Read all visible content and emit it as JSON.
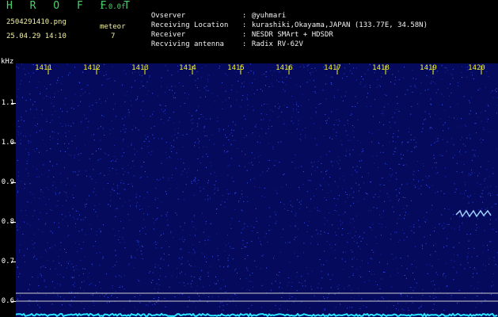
{
  "header": {
    "app_title": "H R O F F T",
    "version": "1.0.0f",
    "filename": "2504291410.png",
    "datetime": "25.04.29 14:10",
    "meteor_label": "meteor",
    "meteor_count": "7"
  },
  "info": [
    {
      "key": "Ovserver",
      "value": "@yuhmari"
    },
    {
      "key": "Receiving Location",
      "value": "kurashiki,Okayama,JAPAN (133.77E, 34.58N)"
    },
    {
      "key": "Receiver",
      "value": "NESDR SMArt + HDSDR"
    },
    {
      "key": "Recviving antenna",
      "value": "Radix RV-62V"
    }
  ],
  "axis": {
    "unit": "kHz",
    "time_ticks": [
      "1411",
      "1412",
      "1413",
      "1414",
      "1415",
      "1416",
      "1417",
      "1418",
      "1419",
      "1420"
    ],
    "freq_labels": [
      "1.1",
      "1.0",
      "0.9",
      "0.8",
      "0.7",
      "0.6"
    ]
  },
  "colors": {
    "background": "#000000",
    "spectrogram_base": "#050a5c",
    "noise": "#2f4fff",
    "meteor_echo": "#9fd0ff",
    "title_green": "#49d36a",
    "tick_yellow": "#f3f31a",
    "baseline_cyan": "#28e6ff"
  }
}
